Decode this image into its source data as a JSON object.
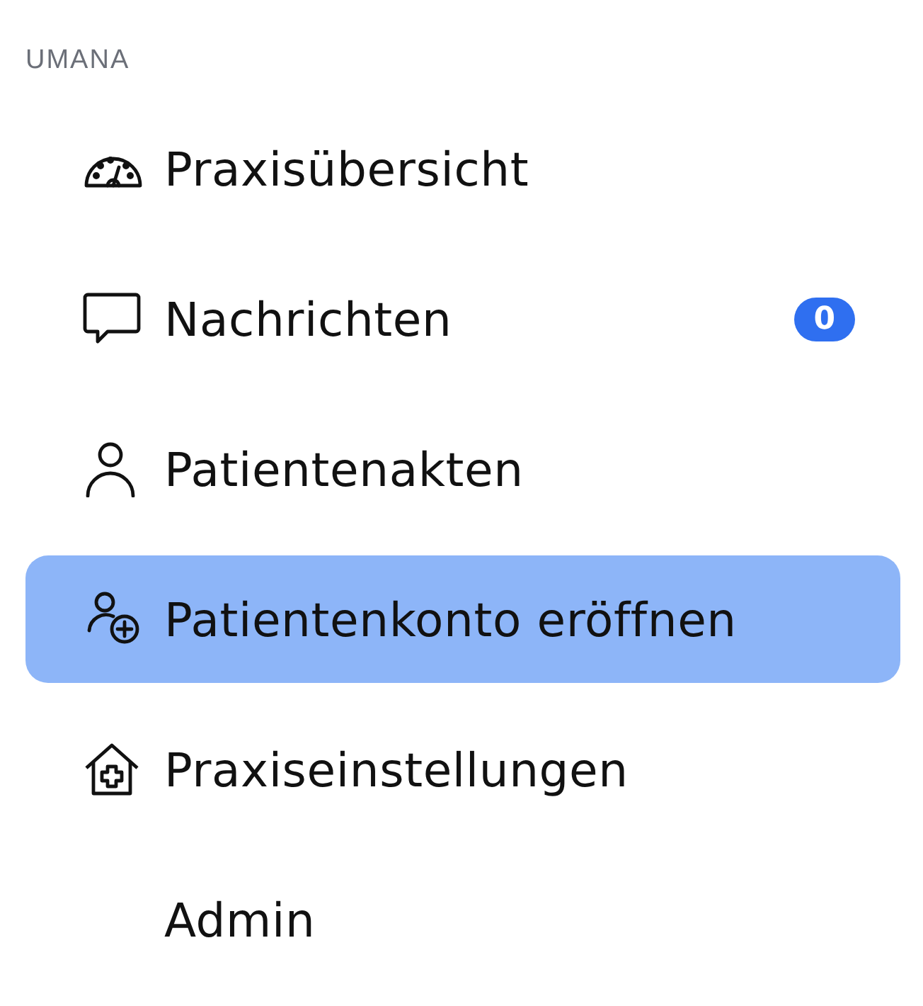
{
  "section_label": "UMANA",
  "items": [
    {
      "kind": "dashboard",
      "label": "Praxisübersicht",
      "selected": false
    },
    {
      "kind": "messages",
      "label": "Nachrichten",
      "badge": "0",
      "selected": false
    },
    {
      "kind": "person",
      "label": "Patientenakten",
      "selected": false
    },
    {
      "kind": "person-add",
      "label": "Patientenkonto eröffnen",
      "selected": true
    },
    {
      "kind": "house-plus",
      "label": "Praxiseinstellungen",
      "selected": false
    },
    {
      "kind": "none",
      "label": "Admin",
      "selected": false
    }
  ]
}
